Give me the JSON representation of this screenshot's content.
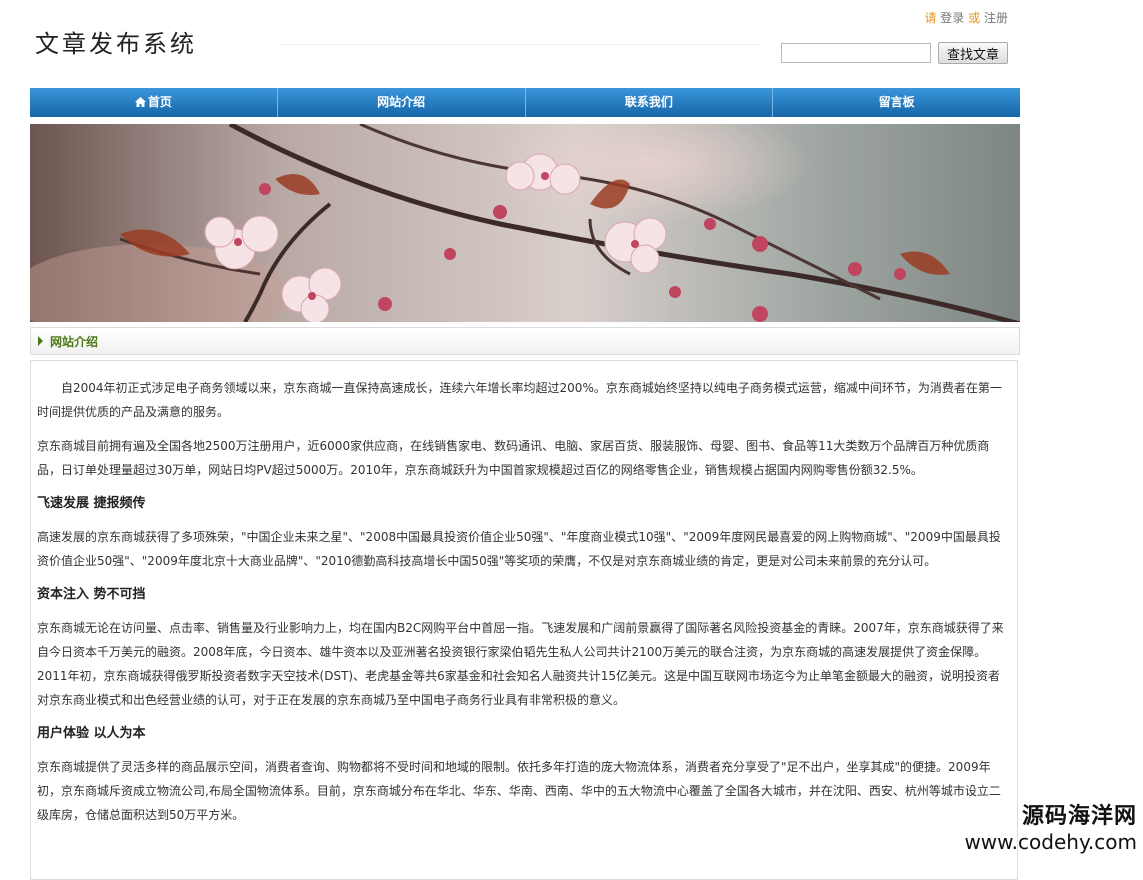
{
  "header": {
    "logo": "文章发布系统",
    "top_prefix": "请",
    "login": "登录",
    "or": "或",
    "register": "注册",
    "search_placeholder": "",
    "search_button": "查找文章"
  },
  "nav": [
    {
      "label": "首页",
      "icon": "home-icon"
    },
    {
      "label": "网站介绍"
    },
    {
      "label": "联系我们"
    },
    {
      "label": "留言板"
    }
  ],
  "section": {
    "title": "网站介绍"
  },
  "content": {
    "p1": "自2004年初正式涉足电子商务领域以来，京东商城一直保持高速成长，连续六年增长率均超过200%。京东商城始终坚持以纯电子商务模式运营，缩减中间环节，为消费者在第一时间提供优质的产品及满意的服务。",
    "p2": "京东商城目前拥有遍及全国各地2500万注册用户，近6000家供应商，在线销售家电、数码通讯、电脑、家居百货、服装服饰、母婴、图书、食品等11大类数万个品牌百万种优质商品，日订单处理量超过30万单，网站日均PV超过5000万。2010年，京东商城跃升为中国首家规模超过百亿的网络零售企业，销售规模占据国内网购零售份额32.5%。",
    "h1": "飞速发展 捷报频传",
    "p3": "高速发展的京东商城获得了多项殊荣，\"中国企业未来之星\"、\"2008中国最具投资价值企业50强\"、\"年度商业模式10强\"、\"2009年度网民最喜爱的网上购物商城\"、\"2009中国最具投资价值企业50强\"、\"2009年度北京十大商业品牌\"、\"2010德勤高科技高增长中国50强\"等奖项的荣膺，不仅是对京东商城业绩的肯定，更是对公司未来前景的充分认可。",
    "h2": "资本注入 势不可挡",
    "p4": "京东商城无论在访问量、点击率、销售量及行业影响力上，均在国内B2C网购平台中首屈一指。飞速发展和广阔前景赢得了国际著名风险投资基金的青睐。2007年，京东商城获得了来自今日资本千万美元的融资。2008年底，今日资本、雄牛资本以及亚洲著名投资银行家梁伯韬先生私人公司共计2100万美元的联合注资，为京东商城的高速发展提供了资金保障。2011年初，京东商城获得俄罗斯投资者数字天空技术(DST)、老虎基金等共6家基金和社会知名人融资共计15亿美元。这是中国互联网市场迄今为止单笔金额最大的融资，说明投资者对京东商业模式和出色经营业绩的认可，对于正在发展的京东商城乃至中国电子商务行业具有非常积极的意义。",
    "h3": "用户体验 以人为本",
    "p5": "京东商城提供了灵活多样的商品展示空间，消费者查询、购物都将不受时间和地域的限制。依托多年打造的庞大物流体系，消费者充分享受了\"足不出户，坐享其成\"的便捷。2009年初，京东商城斥资成立物流公司,布局全国物流体系。目前，京东商城分布在华北、华东、华南、西南、华中的五大物流中心覆盖了全国各大城市，并在沈阳、西安、杭州等城市设立二级库房，仓储总面积达到50万平方米。"
  },
  "watermark": {
    "line1": "源码海洋网",
    "line2": "www.codehy.com"
  }
}
